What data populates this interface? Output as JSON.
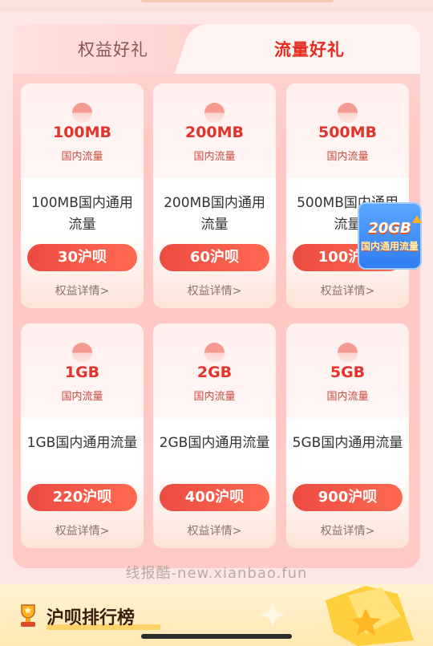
{
  "tabs": {
    "left_label": "权益好礼",
    "right_label": "流量好礼"
  },
  "cards": [
    {
      "size": "100MB",
      "sub": "国内流量",
      "name": "100MB国内通用流量",
      "price": "30沪呗",
      "detail": "权益详情>"
    },
    {
      "size": "200MB",
      "sub": "国内流量",
      "name": "200MB国内通用流量",
      "price": "60沪呗",
      "detail": "权益详情>"
    },
    {
      "size": "500MB",
      "sub": "国内流量",
      "name": "500MB国内通用流量",
      "price": "100沪呗",
      "detail": "权益详情>"
    },
    {
      "size": "1GB",
      "sub": "国内流量",
      "name": "1GB国内通用流量",
      "price": "220沪呗",
      "detail": "权益详情>"
    },
    {
      "size": "2GB",
      "sub": "国内流量",
      "name": "2GB国内通用流量",
      "price": "400沪呗",
      "detail": "权益详情>"
    },
    {
      "size": "5GB",
      "sub": "国内流量",
      "name": "5GB国内通用流量",
      "price": "900沪呗",
      "detail": "权益详情>"
    }
  ],
  "float_badge": {
    "big": "20GB",
    "small": "国内通用流量"
  },
  "watermark": "线报酷-new.xianbao.fun",
  "ranking": {
    "title": "沪呗排行榜"
  },
  "colors": {
    "accent": "#e62a1f",
    "button": "#ec4b41",
    "panel": "#ffc8c4"
  }
}
